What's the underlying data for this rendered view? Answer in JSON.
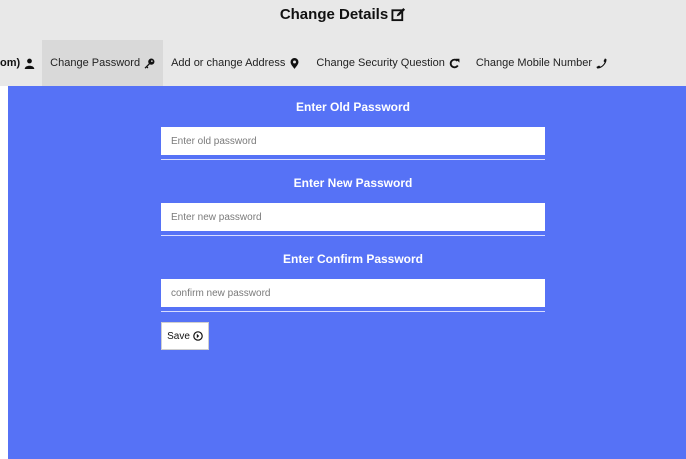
{
  "header": {
    "title": "Change Details",
    "title_icon": "edit-icon"
  },
  "tabs": [
    {
      "label": "om)",
      "icon": "user-icon"
    },
    {
      "label": "Change Password",
      "icon": "key-icon",
      "active": true
    },
    {
      "label": "Add or change Address",
      "icon": "map-marker-icon"
    },
    {
      "label": "Change Security Question",
      "icon": "refresh-icon"
    },
    {
      "label": "Change Mobile Number",
      "icon": "phone-icon"
    }
  ],
  "form": {
    "old_password_label": "Enter Old Password",
    "old_password_placeholder": "Enter old password",
    "new_password_label": "Enter New Password",
    "new_password_placeholder": "Enter new password",
    "confirm_password_label": "Enter Confirm Password",
    "confirm_password_placeholder": "confirm new password",
    "save_label": "Save"
  },
  "colors": {
    "panel_background": "#5672f6",
    "header_background": "#e8e8e8",
    "active_tab_background": "#d9d9d9",
    "label_text": "#ffffff"
  }
}
